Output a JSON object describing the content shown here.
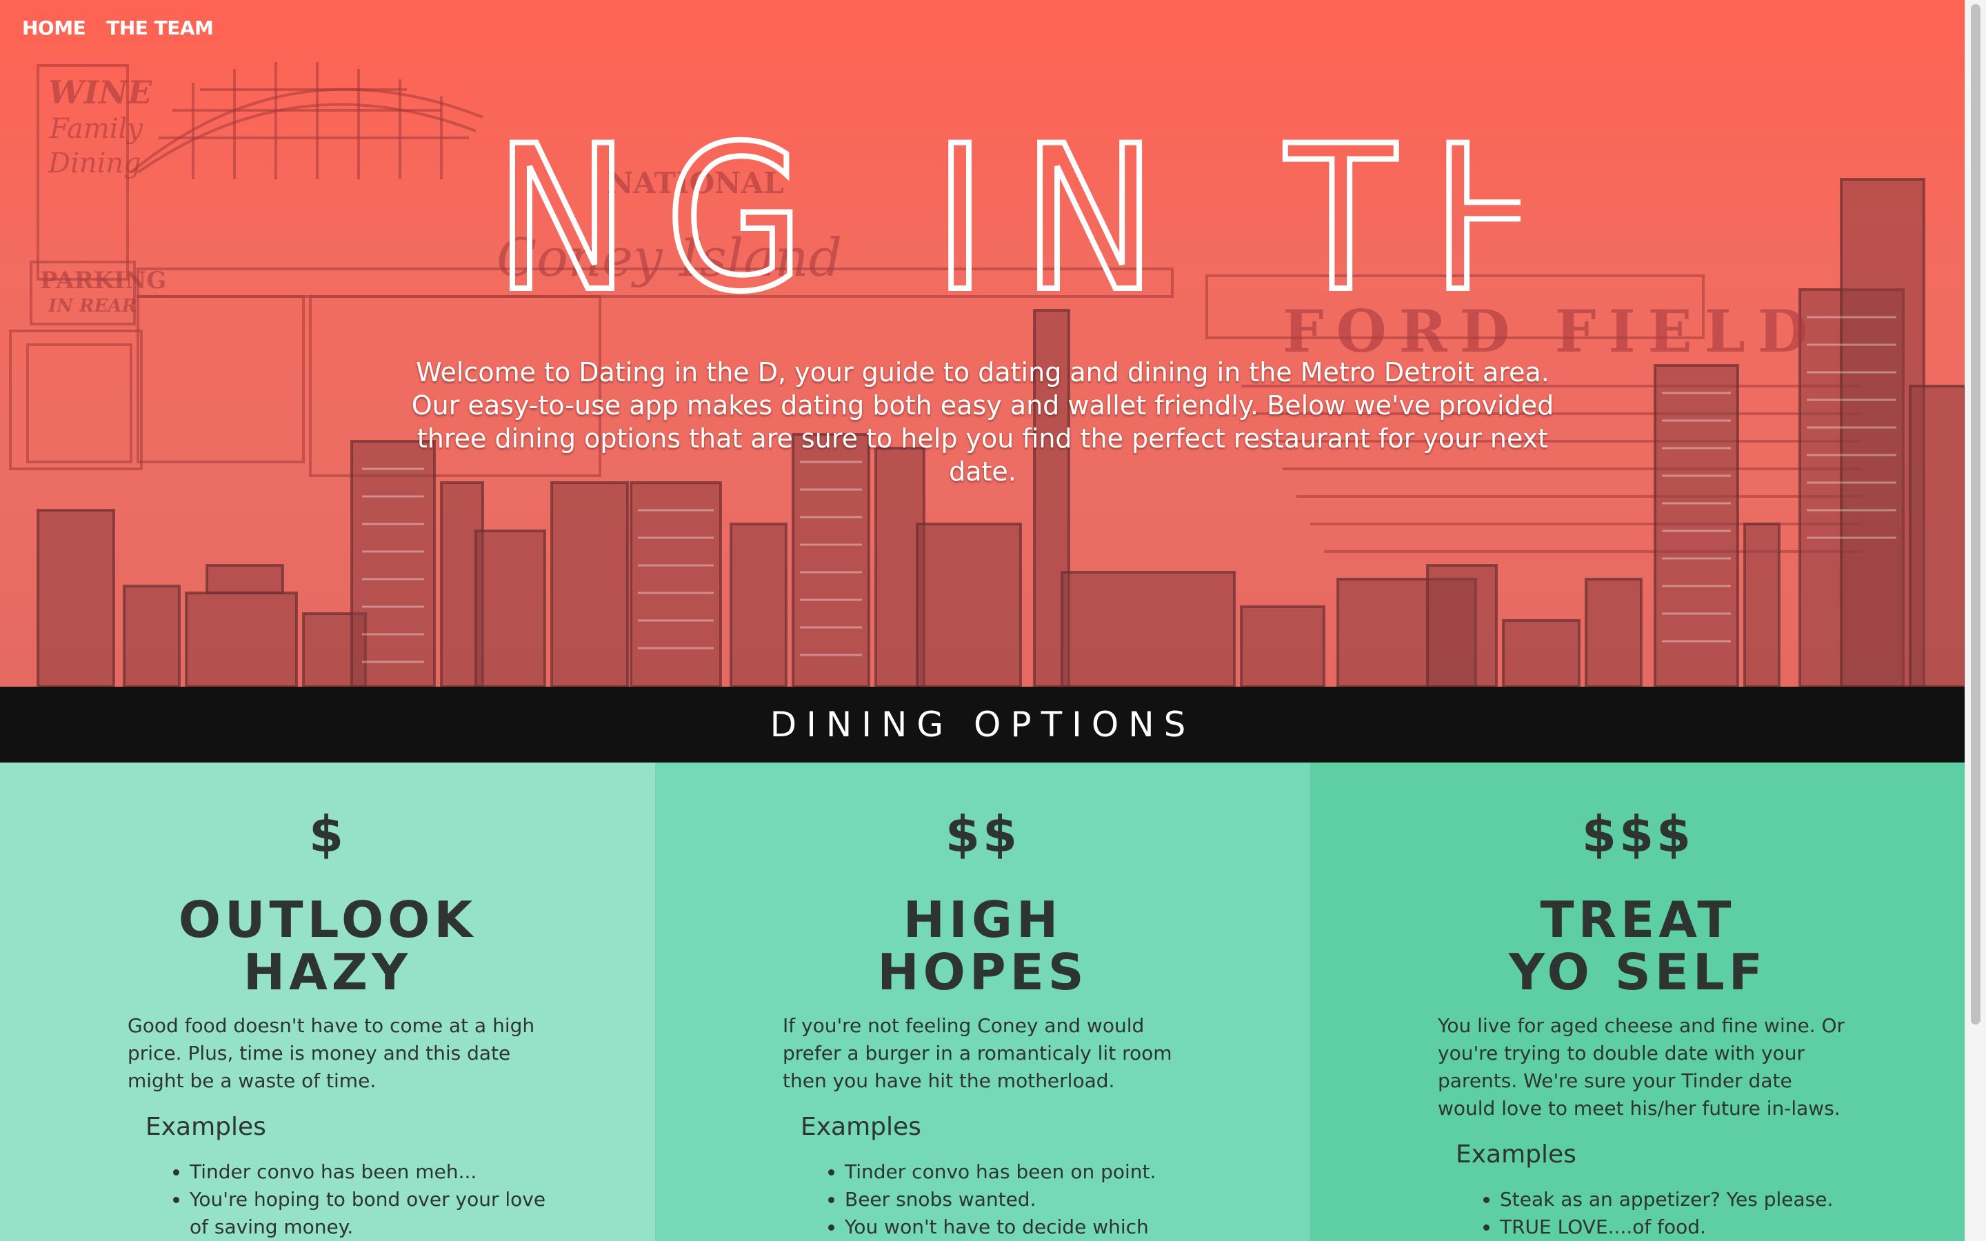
{
  "nav": {
    "home": "HOME",
    "team": "THE TEAM"
  },
  "hero": {
    "title": "DATING IN THE D",
    "intro": "Welcome to Dating in the D, your guide to dating and dining in the Metro Detroit area. Our easy-to-use app makes dating both easy and wallet friendly. Below we've provided three dining options that are sure to help you find the perfect restaurant for your next date.",
    "art_signs": {
      "wine": "WINE",
      "family": "Family",
      "dining": "Dining",
      "parking": "PARKING",
      "in_rear": "IN REAR",
      "coney": "Coney Island",
      "national": "NATIONAL",
      "ford_field": "FORD FIELD"
    }
  },
  "dining": {
    "heading": "DINING OPTIONS",
    "options": [
      {
        "price": "$",
        "title_line1": "OUTLOOK",
        "title_line2": "HAZY",
        "description": "Good food doesn't have to come at a high price. Plus, time is money and this date might be a waste of time.",
        "examples_label": "Examples",
        "examples": [
          "Tinder convo has been meh...",
          "You're hoping to bond over your love of saving money."
        ]
      },
      {
        "price": "$$",
        "title_line1": "HIGH",
        "title_line2": "HOPES",
        "description": "If you're not feeling Coney and would prefer a burger in a romanticaly lit room then you have hit the motherload.",
        "examples_label": "Examples",
        "examples": [
          "Tinder convo has been on point.",
          "Beer snobs wanted.",
          "You won't have to decide which"
        ]
      },
      {
        "price": "$$$",
        "title_line1": "TREAT",
        "title_line2": "YO SELF",
        "description": "You live for aged cheese and fine wine. Or you're trying to double date with your parents. We're sure your Tinder date would love to meet his/her future in-laws.",
        "examples_label": "Examples",
        "examples": [
          "Steak as an appetizer? Yes please.",
          "TRUE LOVE....of food."
        ]
      }
    ]
  },
  "colors": {
    "hero_red": "#f36a5c",
    "bar_black": "#111111",
    "col1": "#96e2c8",
    "col2": "#75d8b6",
    "col3": "#5ecfa4",
    "text_dark": "#2e3432"
  }
}
